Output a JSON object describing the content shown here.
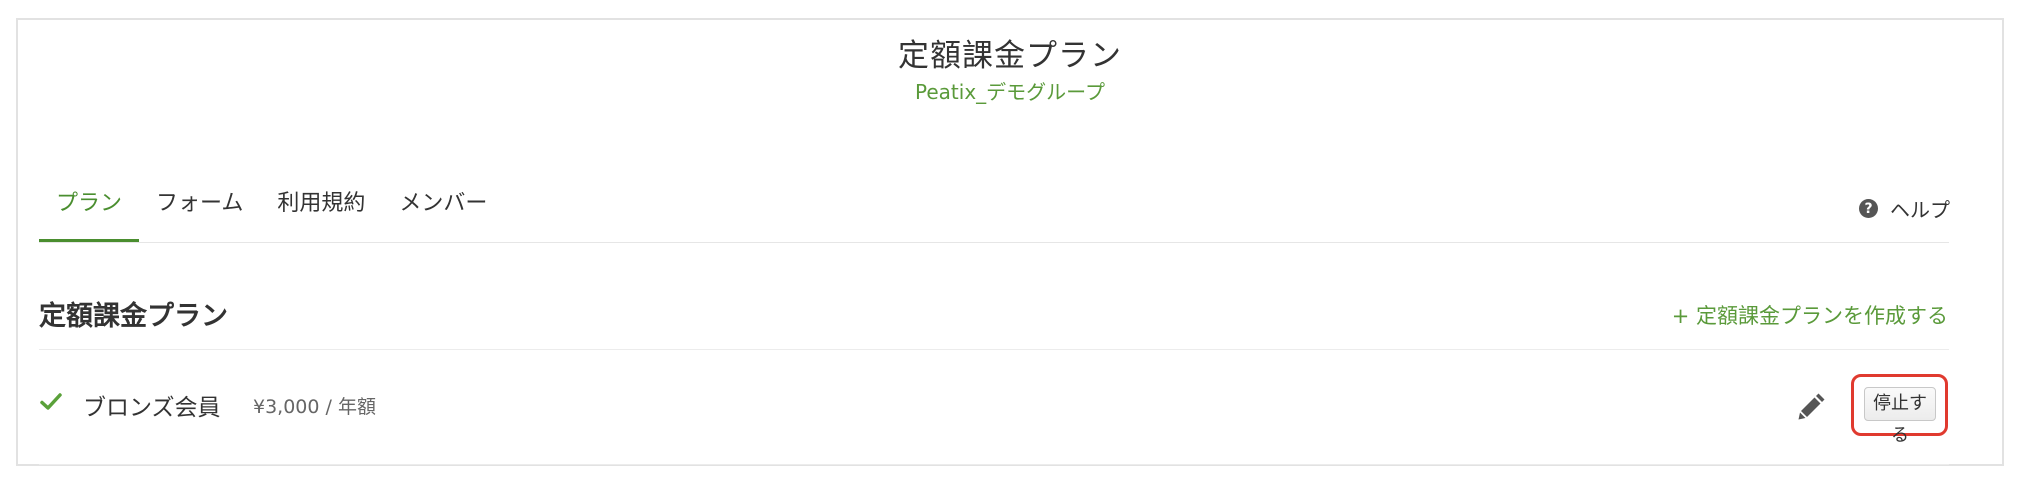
{
  "header": {
    "title": "定額課金プラン",
    "org_name": "Peatix_デモグループ"
  },
  "tabs": [
    {
      "label": "プラン",
      "active": true
    },
    {
      "label": "フォーム",
      "active": false
    },
    {
      "label": "利用規約",
      "active": false
    },
    {
      "label": "メンバー",
      "active": false
    }
  ],
  "help": {
    "icon": "question-circle-icon",
    "label": "ヘルプ"
  },
  "section": {
    "title": "定額課金プラン",
    "create_link": "+ 定額課金プランを作成する"
  },
  "plans": [
    {
      "status_icon": "check-icon",
      "name": "ブロンズ会員",
      "price": "¥3,000 / 年額",
      "edit_icon": "pencil-icon",
      "stop_label": "停止する"
    }
  ],
  "colors": {
    "accent": "#4a8e2f",
    "highlight": "#e03a2f"
  }
}
